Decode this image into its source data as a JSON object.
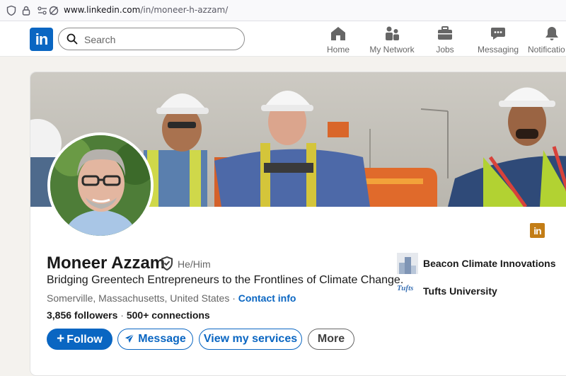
{
  "browser": {
    "url_host": "www.linkedin.com",
    "url_path": "/in/moneer-h-azzam/"
  },
  "nav": {
    "logo_text": "in",
    "search_placeholder": "Search",
    "items": [
      {
        "label": "Home",
        "icon": "home-icon"
      },
      {
        "label": "My Network",
        "icon": "network-icon"
      },
      {
        "label": "Jobs",
        "icon": "briefcase-icon"
      },
      {
        "label": "Messaging",
        "icon": "messaging-icon"
      },
      {
        "label": "Notificatio",
        "icon": "bell-icon"
      }
    ]
  },
  "profile": {
    "name": "Moneer Azzam",
    "pronouns": "He/Him",
    "headline": "Bridging Greentech Entrepreneurs to the Frontlines of Climate Change.",
    "location": "Somerville, Massachusetts, United States",
    "contact_label": "Contact info",
    "followers": "3,856 followers",
    "separator": "·",
    "connections": "500+ connections",
    "badge_text": "in"
  },
  "actions": {
    "follow": "Follow",
    "follow_prefix": "+",
    "message": "Message",
    "services": "View my services",
    "more": "More"
  },
  "orgs": [
    {
      "name": "Beacon Climate Innovations",
      "logo_text": ""
    },
    {
      "name": "Tufts University",
      "logo_text": "Tufts"
    }
  ],
  "colors": {
    "brand": "#0a66c2",
    "background": "#f4f2ee",
    "badge": "#c37d16"
  }
}
